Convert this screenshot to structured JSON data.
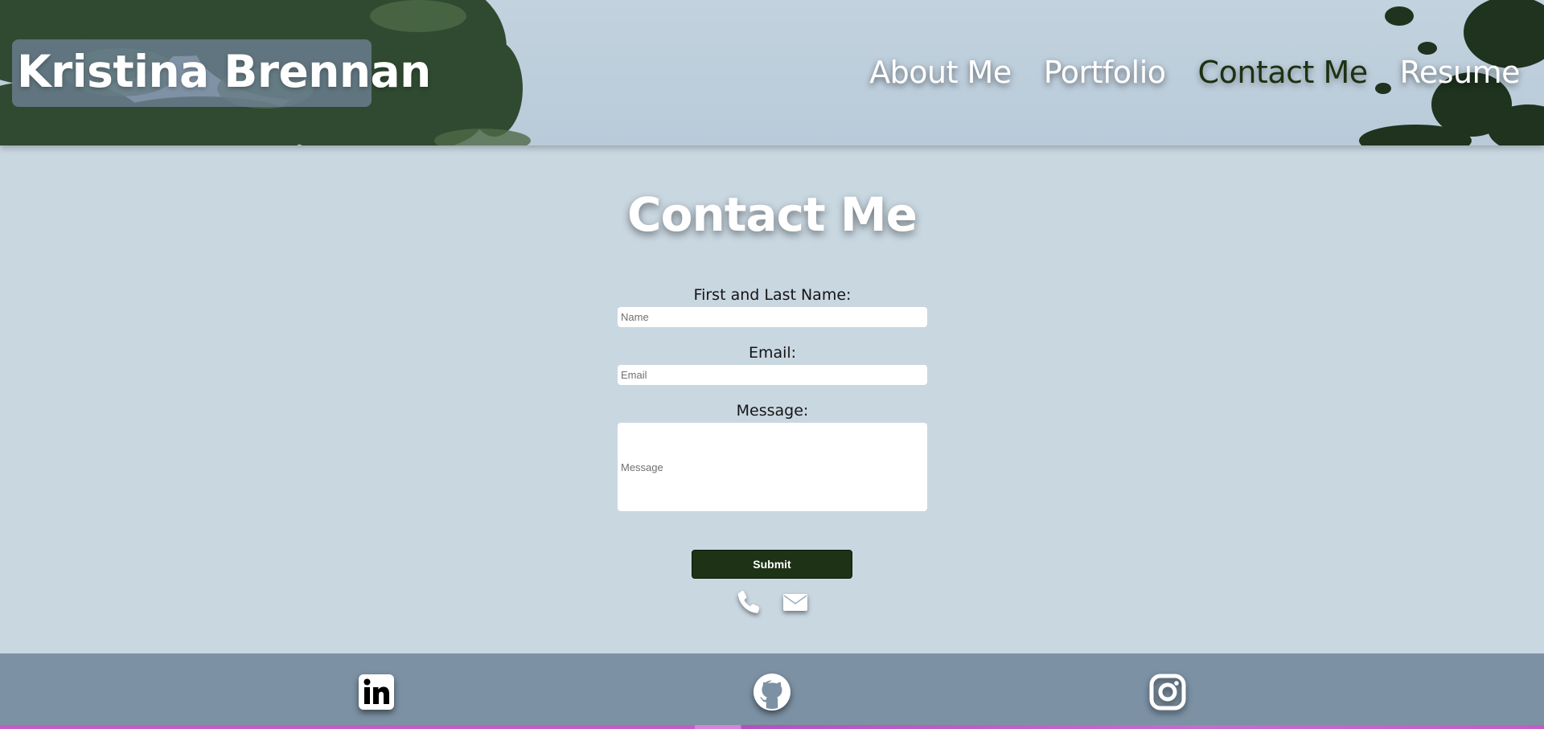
{
  "header": {
    "brand": "Kristina Brennan",
    "nav": [
      {
        "label": "About Me",
        "active": false
      },
      {
        "label": "Portfolio",
        "active": false
      },
      {
        "label": "Contact Me",
        "active": true
      },
      {
        "label": "Resume",
        "active": false
      }
    ]
  },
  "main": {
    "title": "Contact Me",
    "form": {
      "name_label": "First and Last Name:",
      "name_placeholder": "Name",
      "email_label": "Email:",
      "email_placeholder": "Email",
      "message_label": "Message:",
      "message_placeholder": "Message",
      "submit_label": "Submit"
    },
    "contact_icons": [
      "phone-icon",
      "envelope-icon"
    ]
  },
  "footer": {
    "social_icons": [
      "linkedin-icon",
      "github-icon",
      "instagram-icon"
    ]
  },
  "colors": {
    "page_background": "#c9d7e1",
    "footer_background": "#7c91a4",
    "active_nav": "#1d3113",
    "submit_button": "#1e3216",
    "accent_bar": "#c35cc8"
  }
}
